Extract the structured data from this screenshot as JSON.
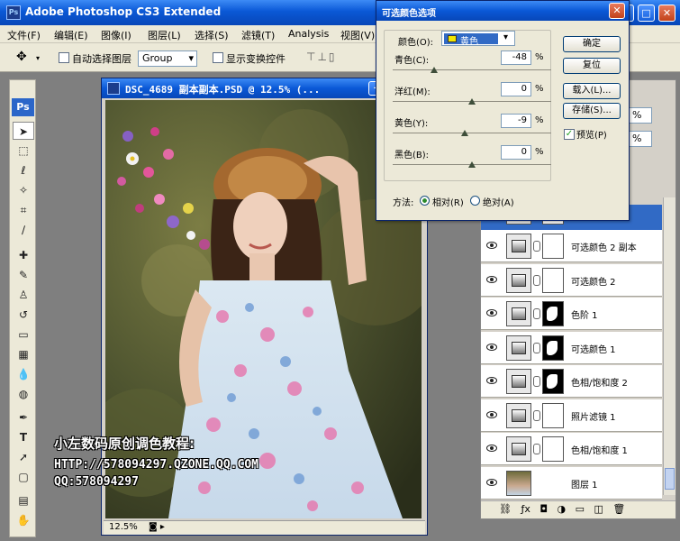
{
  "app": {
    "title": "Adobe Photoshop CS3 Extended",
    "icon_text": "Ps"
  },
  "menu": [
    "文件(F)",
    "编辑(E)",
    "图像(I)",
    "图层(L)",
    "选择(S)",
    "滤镜(T)",
    "Analysis",
    "视图(V)"
  ],
  "options": {
    "auto_select_label": "自动选择图层",
    "group_value": "Group",
    "show_transform_label": "显示变换控件"
  },
  "toolbox": {
    "logo": "Ps"
  },
  "document": {
    "title": "DSC_4689 副本副本.PSD @ 12.5% (...",
    "zoom": "12.5%"
  },
  "watermark": {
    "line1": "小左数码原创调色教程:",
    "line2": "HTTP://578094297.QZONE.QQ.COM",
    "line3": "QQ:578094297"
  },
  "dialog": {
    "title": "可选颜色选项",
    "colors_label": "颜色(O):",
    "colors_value": "黄色",
    "swatch": "#f2e600",
    "sliders": [
      {
        "label": "青色(C):",
        "value": "-48",
        "unit": "%",
        "level": -48
      },
      {
        "label": "洋红(M):",
        "value": "0",
        "unit": "%",
        "level": 0
      },
      {
        "label": "黄色(Y):",
        "value": "-9",
        "unit": "%",
        "level": -9
      },
      {
        "label": "黑色(B):",
        "value": "0",
        "unit": "%",
        "level": 0
      }
    ],
    "buttons": {
      "ok": "确定",
      "reset": "复位",
      "load": "载入(L)...",
      "save": "存储(S)...",
      "preview": "预览(P)"
    },
    "method_label": "方法:",
    "method_relative": "相对(R)",
    "method_absolute": "绝对(A)"
  },
  "layers": {
    "rows": [
      {
        "name": "可选颜色 2 副本",
        "mask": "white",
        "icon": "selective-color-icon"
      },
      {
        "name": "可选颜色 2",
        "mask": "white",
        "icon": "selective-color-icon"
      },
      {
        "name": "色阶 1",
        "mask": "black",
        "icon": "levels-icon"
      },
      {
        "name": "可选颜色 1",
        "mask": "black",
        "icon": "selective-color-icon"
      },
      {
        "name": "色相/饱和度 2",
        "mask": "black",
        "icon": "hue-saturation-icon"
      },
      {
        "name": "照片滤镜 1",
        "mask": "white",
        "icon": "photo-filter-icon"
      },
      {
        "name": "色相/饱和度 1",
        "mask": "white",
        "icon": "hue-saturation-icon"
      },
      {
        "name": "图层 1",
        "mask": "none",
        "icon": "image-thumbnail"
      }
    ],
    "pct1": "%",
    "pct2": "%"
  }
}
